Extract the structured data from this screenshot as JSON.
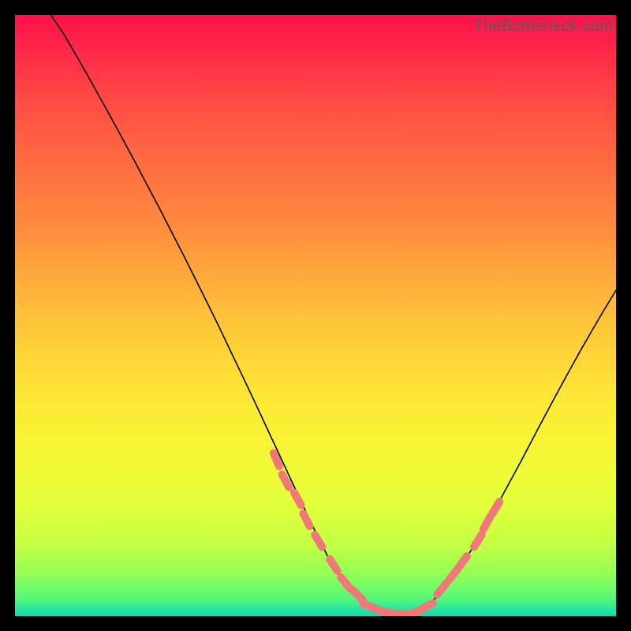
{
  "watermark": "TheBottleneck.com",
  "colors": {
    "frame_background": "#000000",
    "curve_stroke": "#000000",
    "marker_fill": "#f07878",
    "watermark_text": "#5a5a5a",
    "gradient_stops": [
      "#ff104a",
      "#ff2d48",
      "#ff4a45",
      "#ff6142",
      "#ff7640",
      "#ff8b3e",
      "#ffa43c",
      "#ffbe3a",
      "#ffd338",
      "#fee636",
      "#f9f335",
      "#f0fa37",
      "#e1ff3b",
      "#c4ff44",
      "#94fe55",
      "#57f977",
      "#25e5a1",
      "#13d8b8"
    ]
  },
  "chart_data": {
    "type": "line",
    "title": "",
    "xlabel": "",
    "ylabel": "",
    "xlim": [
      0,
      100
    ],
    "ylim": [
      0,
      100
    ],
    "x": [
      6,
      8,
      10,
      12,
      14,
      16,
      18,
      20,
      22,
      24,
      26,
      28,
      30,
      32,
      34,
      36,
      38,
      40,
      42,
      44,
      46,
      48,
      50,
      52,
      54,
      56,
      58,
      60,
      62,
      64,
      65,
      66,
      68,
      70,
      72,
      74,
      76,
      78,
      80,
      82,
      84,
      86,
      88,
      90,
      92,
      94,
      96,
      98,
      100
    ],
    "values": [
      100,
      97,
      93.6,
      90.1,
      86.5,
      82.9,
      79.2,
      75.5,
      71.7,
      67.9,
      64.0,
      60.1,
      56.1,
      52.1,
      48.0,
      43.8,
      39.6,
      35.4,
      31.1,
      26.8,
      22.5,
      18.2,
      14.0,
      10.0,
      6.6,
      4.0,
      2.2,
      1.0,
      0.4,
      0.2,
      0.2,
      0.4,
      1.3,
      3.0,
      5.3,
      8.0,
      11.1,
      14.5,
      18.0,
      21.7,
      25.4,
      29.2,
      33.0,
      36.7,
      40.4,
      44.0,
      47.5,
      50.9,
      54.2
    ],
    "markers": {
      "left_branch_x": [
        43.5,
        45.0,
        47.0,
        48.5,
        50.5,
        53.0,
        55.0,
        57.0
      ],
      "left_branch_y": [
        26.0,
        22.5,
        19.5,
        16.0,
        12.5,
        8.5,
        5.5,
        3.5
      ],
      "right_branch_x": [
        71.0,
        73.0,
        74.5,
        77.0,
        78.5,
        80.0
      ],
      "right_branch_y": [
        4.5,
        7.0,
        9.0,
        12.5,
        15.5,
        18.0
      ],
      "bottom_x": [
        59.0,
        60.5,
        62.0,
        63.5,
        65.5,
        67.0,
        68.5
      ],
      "bottom_y": [
        1.6,
        1.0,
        0.6,
        0.4,
        0.4,
        0.8,
        1.6
      ]
    }
  }
}
